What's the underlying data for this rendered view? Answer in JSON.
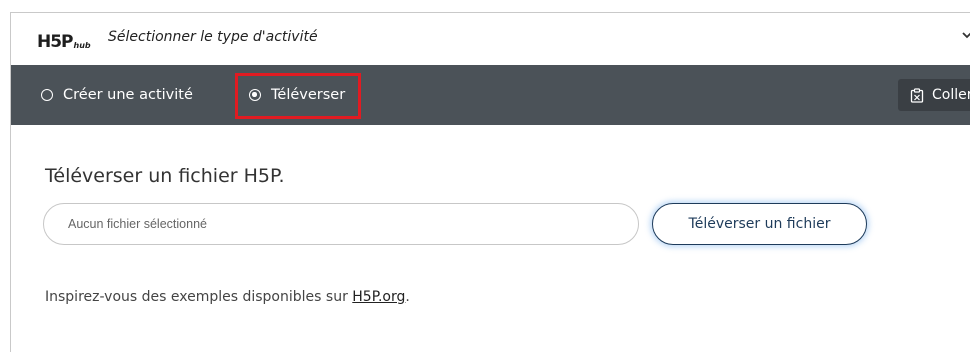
{
  "header": {
    "logo_main": "H5P",
    "logo_sub": "hub",
    "title": "Sélectionner le type d'activité",
    "chevron_icon": "chevron-down-icon"
  },
  "tabs": [
    {
      "label": "Créer une activité",
      "selected": false
    },
    {
      "label": "Téléverser",
      "selected": true
    }
  ],
  "paste_button": {
    "label": "Coller",
    "icon": "clipboard-icon"
  },
  "upload_panel": {
    "title": "Téléverser un fichier H5P.",
    "file_input_placeholder": "Aucun fichier sélectionné",
    "upload_button_label": "Téléverser un fichier",
    "inspire_text": "Inspirez-vous des exemples disponibles sur ",
    "inspire_link": "H5P.org",
    "inspire_suffix": "."
  },
  "colors": {
    "tabbar_bg": "#4b5258",
    "highlight": "#e11b22",
    "button_border": "#1e3b5a"
  }
}
